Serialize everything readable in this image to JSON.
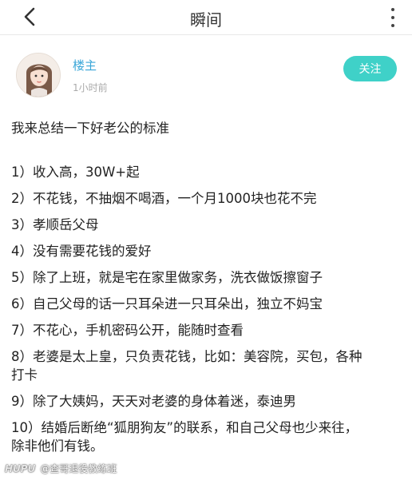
{
  "header": {
    "title": "瞬间"
  },
  "post": {
    "author": "楼主",
    "time": "1小时前",
    "follow_label": "关注",
    "intro": "我来总结一下好老公的标准",
    "items": [
      "1）收入高，30W+起",
      "2）不花钱，不抽烟不喝酒，一个月1000块也花不完",
      "3）孝顺岳父母",
      "4）没有需要花钱的爱好",
      "5）除了上班，就是宅在家里做家务，洗衣做饭擦窗子",
      "6）自己父母的话一只耳朵进一只耳朵出，独立不妈宝",
      "7）不花心，手机密码公开，能随时查看",
      "8）老婆是太上皇，只负责花钱，比如：美容院，买包，各种",
      "打卡",
      "9）除了大姨妈，天天对老婆的身体着迷，泰迪男",
      "10）结婚后断绝“狐朋狗友”的联系，和自己父母也少来往，",
      "除非他们有钱。"
    ]
  },
  "watermark": {
    "brand": "HUPU",
    "handle": "@查哥退役教练班"
  },
  "colors": {
    "accent": "#3fd1c8",
    "author": "#3aa6d8"
  },
  "icons": {
    "back": "chevron-left-icon",
    "more": "more-vertical-icon",
    "avatar": "avatar"
  }
}
